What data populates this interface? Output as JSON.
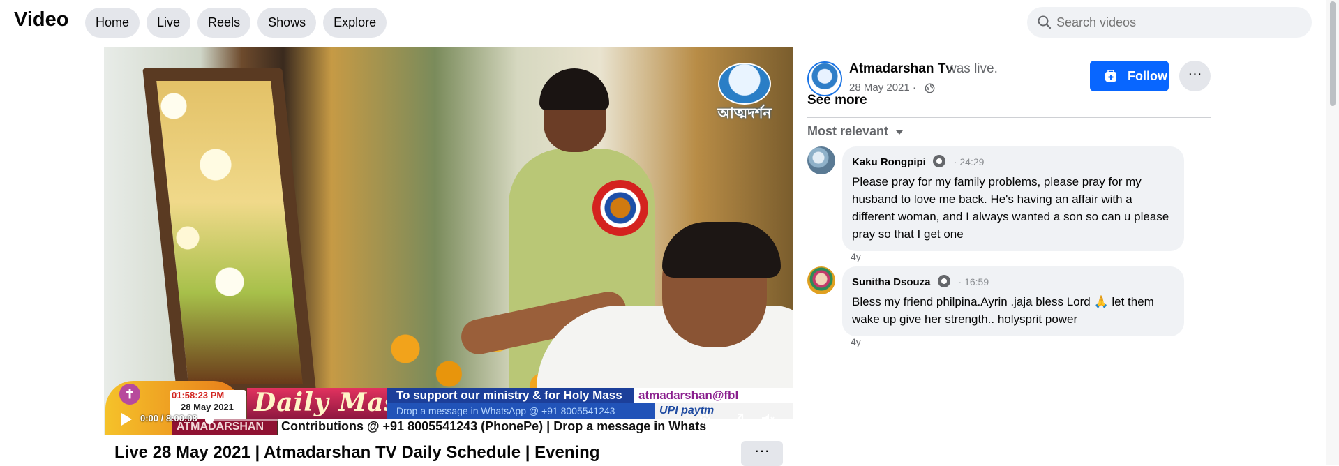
{
  "header": {
    "brand": "Video",
    "nav": [
      {
        "label": "Home"
      },
      {
        "label": "Live"
      },
      {
        "label": "Reels"
      },
      {
        "label": "Shows"
      },
      {
        "label": "Explore"
      }
    ],
    "search_placeholder": "Search videos"
  },
  "video": {
    "overlay": {
      "logo_text": "আত্মদর্শন",
      "clock": "01:58:23 PM",
      "date": "28 May 2021",
      "program": "Daily Mass",
      "support_text": "To support our ministry & for Holy Mass offerings :",
      "whatsapp_text": "Drop a message in WhatsApp @ +91 8005541243",
      "email": "atmadarshan@fbl",
      "upi": "UPI paytm",
      "channel": "ATMADARSHAN TV",
      "ticker": "Contributions @ +91 8005541243 (PhonePe) | Drop a message in Whats"
    },
    "player": {
      "time": "0:00 / 8:00:08",
      "progress": 0
    },
    "title": "Live 28 May 2021 | Atmadarshan TV Daily Schedule | Evening",
    "more_label": "···"
  },
  "side": {
    "page_name": "Atmadarshan Tv",
    "status": "was live.",
    "date": "28 May 2021 ·",
    "see_more": "See more",
    "follow_label": "Follow",
    "more_label": "···",
    "sort_label": "Most relevant",
    "comments": [
      {
        "author": "Kaku Rongpipi",
        "time": "· 24:29",
        "text": "Please pray for my family problems, please pray for my husband to love me back. He's having an affair with a different woman, and I always wanted a son so can u please pray so that I get one",
        "age": "4y"
      },
      {
        "author": "Sunitha Dsouza",
        "time": "· 16:59",
        "text": "Bless my friend philpina.Ayrin .jaja bless Lord 🙏 let them wake up give her strength.. holysprit power",
        "age": "4y"
      }
    ]
  },
  "colors": {
    "accent": "#0866ff",
    "pill_bg": "#e4e6eb",
    "secondary_text": "#65676b"
  }
}
